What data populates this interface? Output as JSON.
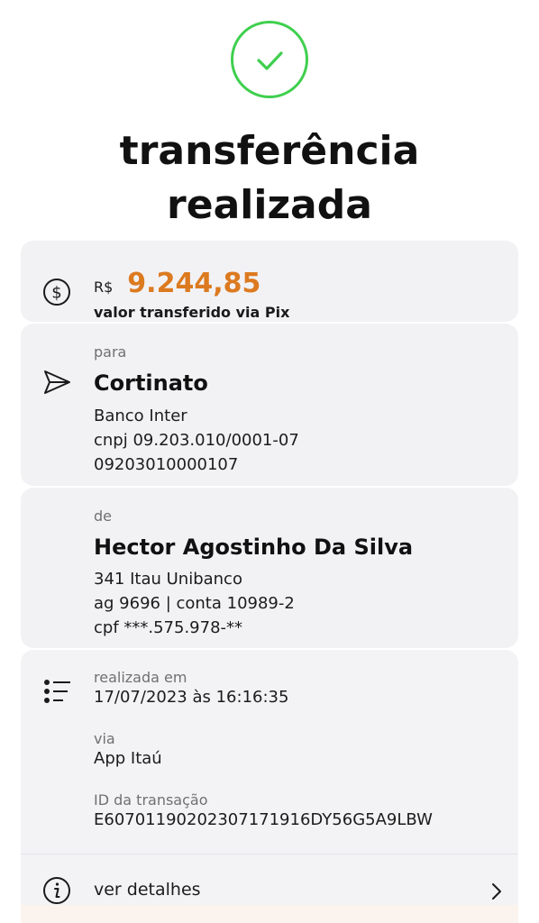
{
  "header": {
    "title_line1": "transferência",
    "title_line2": "realizada"
  },
  "amount": {
    "currency": "R$",
    "value": "9.244,85",
    "caption": "valor transferido via Pix"
  },
  "recipient": {
    "label": "para",
    "name": "Cortinato",
    "bank": " Banco Inter",
    "document": "cnpj 09.203.010/0001-07",
    "key": "09203010000107"
  },
  "sender": {
    "label": "de",
    "name": "Hector Agostinho Da Silva",
    "bank": "341 Itau Unibanco",
    "account": "ag 9696 | conta 10989-2",
    "document": "cpf ***.575.978-**"
  },
  "info": {
    "date_label": "realizada em",
    "date_value": "17/07/2023 às 16:16:35",
    "channel_label": "via",
    "channel_value": "App Itaú",
    "id_label": "ID da transação",
    "id_value": "E60701190202307171916DY56G5A9LBW",
    "details_label": "ver detalhes"
  },
  "icons": {
    "success": "check-circle-icon",
    "amount": "dollar-circle-icon",
    "recipient": "send-icon",
    "info": "list-icon",
    "details": "info-icon",
    "chevron": "chevron-right-icon"
  },
  "colors": {
    "success": "#3fcf4e",
    "amount": "#dc7a20",
    "card": "#f2f2f5"
  }
}
